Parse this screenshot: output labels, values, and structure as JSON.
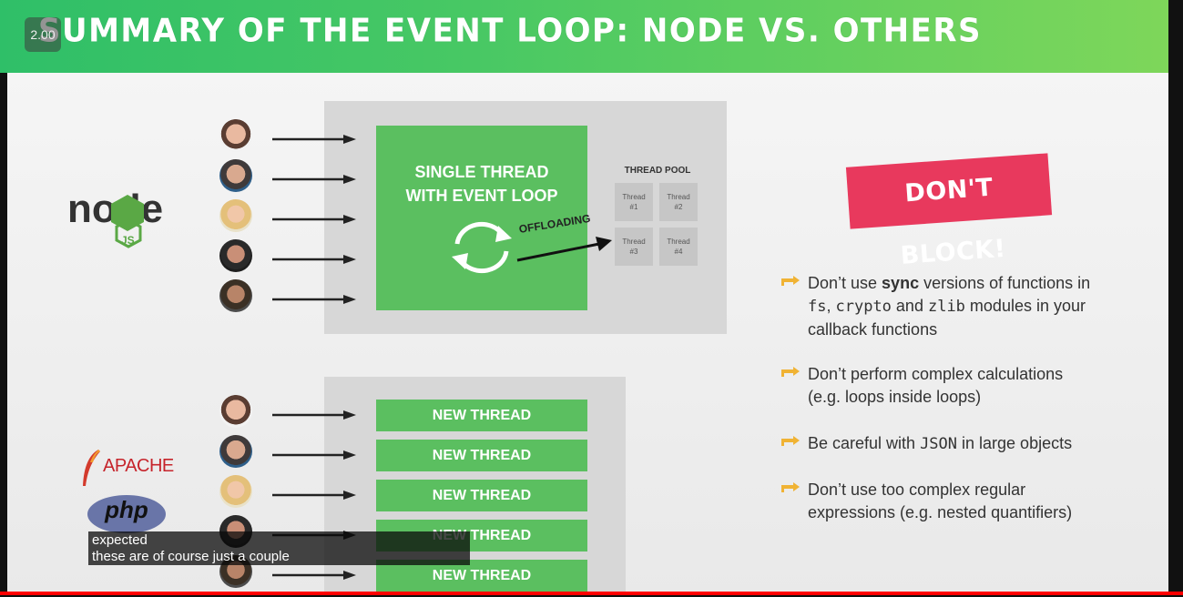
{
  "video": {
    "speed_badge": "2.00"
  },
  "slide": {
    "title": "SUMMARY OF THE EVENT LOOP: NODE VS. OTHERS",
    "node_section": {
      "logo_text_main": "node",
      "logo_text_sub": "JS",
      "main_box_line1": "SINGLE THREAD",
      "main_box_line2": "WITH EVENT LOOP",
      "offloading_label": "OFFLOADING",
      "thread_pool_label": "THREAD POOL",
      "threads": [
        {
          "label": "Thread",
          "num": "#1"
        },
        {
          "label": "Thread",
          "num": "#2"
        },
        {
          "label": "Thread",
          "num": "#3"
        },
        {
          "label": "Thread",
          "num": "#4"
        }
      ]
    },
    "others_section": {
      "apache_label": "APACHE",
      "php_label": "php",
      "new_thread_labels": [
        "NEW THREAD",
        "NEW THREAD",
        "NEW THREAD",
        "NEW THREAD",
        "NEW THREAD"
      ]
    },
    "dont_block": "DON'T BLOCK!",
    "tips": {
      "t1_a": "Don’t use ",
      "t1_sync": "sync",
      "t1_b": " versions of functions in",
      "t1_fs": "fs",
      "t1_c": ", ",
      "t1_crypto": "crypto",
      "t1_d": " and ",
      "t1_zlib": "zlib",
      "t1_e": " modules in your",
      "t1_f": "callback functions",
      "t2_a": "Don’t perform complex calculations",
      "t2_b": "(e.g. loops inside loops)",
      "t3_a": "Be careful with ",
      "t3_json": "JSON",
      "t3_b": " in large objects",
      "t4_a": "Don’t use too complex regular",
      "t4_b": "expressions (e.g. nested quantifiers)"
    },
    "colors": {
      "green": "#5bbf60",
      "dont_block_bg": "#e8395d",
      "panel_grey": "#d7d7d7"
    }
  },
  "captions": {
    "line1": "expected",
    "line2": "these are of course just a couple"
  }
}
